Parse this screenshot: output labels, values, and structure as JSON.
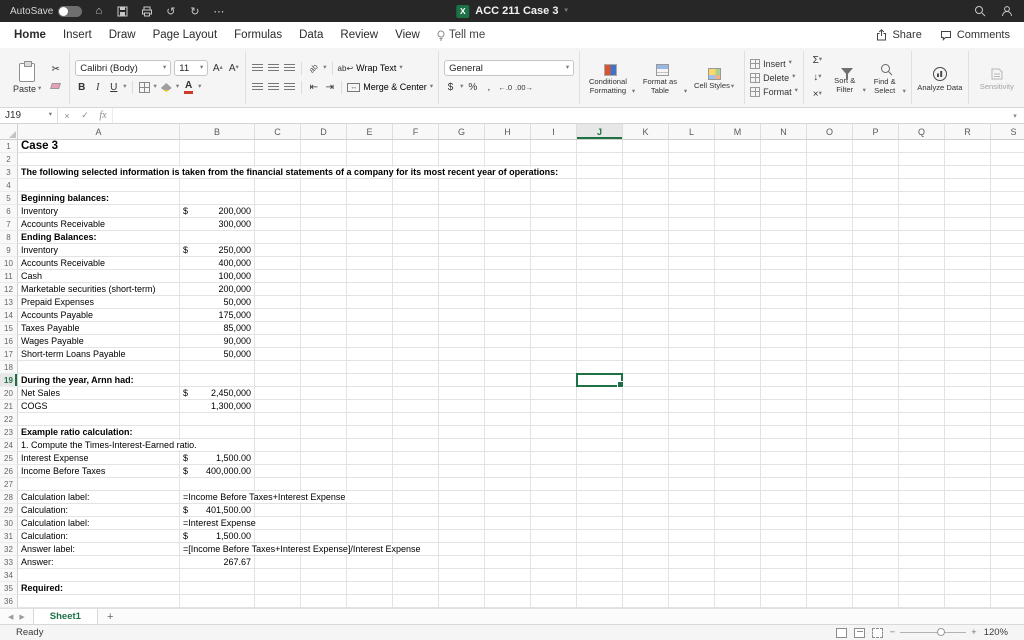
{
  "titlebar": {
    "autosave_label": "AutoSave",
    "autosave_state": "Off",
    "title": "ACC 211 Case 3",
    "more_label": "⋯"
  },
  "menubar": {
    "tabs": [
      "Home",
      "Insert",
      "Draw",
      "Page Layout",
      "Formulas",
      "Data",
      "Review",
      "View"
    ],
    "active_tab": "Home",
    "tell_me": "Tell me",
    "share": "Share",
    "comments": "Comments"
  },
  "ribbon": {
    "paste": "Paste",
    "font_name": "Calibri (Body)",
    "font_size": "11",
    "bold": "B",
    "italic": "I",
    "underline": "U",
    "wrap_text": "Wrap Text",
    "merge_center": "Merge & Center",
    "number_format": "General",
    "currency": "$",
    "percent": "%",
    "comma": ",",
    "increase_decimal": "←.0",
    "decrease_decimal": ".00→",
    "conditional_formatting": "Conditional Formatting",
    "format_as_table": "Format as Table",
    "cell_styles": "Cell Styles",
    "insert": "Insert",
    "delete": "Delete",
    "format": "Format",
    "autosum": "Σ",
    "sort_filter": "Sort & Filter",
    "find_select": "Find & Select",
    "analyze_data": "Analyze Data",
    "sensitivity": "Sensitivity"
  },
  "formula_bar": {
    "name_box": "J19",
    "cancel": "×",
    "enter": "✓",
    "fx": "fx"
  },
  "grid": {
    "columns": [
      "A",
      "B",
      "C",
      "D",
      "E",
      "F",
      "G",
      "H",
      "I",
      "J",
      "K",
      "L",
      "M",
      "N",
      "O",
      "P",
      "Q",
      "R",
      "S"
    ],
    "selected_cell": {
      "column": "J",
      "row": 19
    },
    "rows": [
      {
        "n": 1,
        "a": "Case 3",
        "title": true
      },
      {
        "n": 2
      },
      {
        "n": 3,
        "a": "The following selected information is taken from the financial statements of a company for its most recent year of operations:",
        "bold": true,
        "spill": true
      },
      {
        "n": 4
      },
      {
        "n": 5,
        "a": "Beginning balances:",
        "bold": true
      },
      {
        "n": 6,
        "a": "Inventory",
        "cur": "$",
        "val": "200,000"
      },
      {
        "n": 7,
        "a": "Accounts Receivable",
        "val": "300,000"
      },
      {
        "n": 8,
        "a": "Ending Balances:",
        "bold": true
      },
      {
        "n": 9,
        "a": "Inventory",
        "cur": "$",
        "val": "250,000"
      },
      {
        "n": 10,
        "a": "Accounts Receivable",
        "val": "400,000"
      },
      {
        "n": 11,
        "a": "Cash",
        "val": "100,000"
      },
      {
        "n": 12,
        "a": "Marketable securities (short-term)",
        "val": "200,000"
      },
      {
        "n": 13,
        "a": "Prepaid Expenses",
        "val": "50,000"
      },
      {
        "n": 14,
        "a": "Accounts Payable",
        "val": "175,000"
      },
      {
        "n": 15,
        "a": "Taxes Payable",
        "val": "85,000"
      },
      {
        "n": 16,
        "a": "Wages Payable",
        "val": "90,000"
      },
      {
        "n": 17,
        "a": "Short-term Loans Payable",
        "val": "50,000"
      },
      {
        "n": 18
      },
      {
        "n": 19,
        "a": "During the year, Arnn had:",
        "bold": true
      },
      {
        "n": 20,
        "a": "Net Sales",
        "cur": "$",
        "val": "2,450,000"
      },
      {
        "n": 21,
        "a": "COGS",
        "val": "1,300,000"
      },
      {
        "n": 22
      },
      {
        "n": 23,
        "a": "Example ratio calculation:",
        "bold": true
      },
      {
        "n": 24,
        "a": "1. Compute the Times-Interest-Earned ratio.",
        "spill": true
      },
      {
        "n": 25,
        "a": "Interest Expense",
        "cur": "$",
        "val": "1,500.00"
      },
      {
        "n": 26,
        "a": "Income Before Taxes",
        "cur": "$",
        "val": "400,000.00"
      },
      {
        "n": 27
      },
      {
        "n": 28,
        "a": "Calculation label:",
        "formula": "=Income Before Taxes+Interest Expense"
      },
      {
        "n": 29,
        "a": "Calculation:",
        "cur": "$",
        "val": "401,500.00"
      },
      {
        "n": 30,
        "a": "Calculation label:",
        "formula": "=Interest Expense"
      },
      {
        "n": 31,
        "a": "Calculation:",
        "cur": "$",
        "val": "1,500.00"
      },
      {
        "n": 32,
        "a": "Answer label:",
        "formula": "=[Income Before Taxes+Interest Expense]/Interest Expense"
      },
      {
        "n": 33,
        "a": "Answer:",
        "val": "267.67"
      },
      {
        "n": 34
      },
      {
        "n": 35,
        "a": "Required:",
        "bold": true
      },
      {
        "n": 36
      }
    ]
  },
  "sheet_tabs": {
    "tabs": [
      "Sheet1"
    ],
    "active": "Sheet1",
    "add": "+"
  },
  "status_bar": {
    "status": "Ready",
    "zoom": "120%"
  },
  "colors": {
    "accent": "#1e7145",
    "titlebar": "#272727"
  }
}
